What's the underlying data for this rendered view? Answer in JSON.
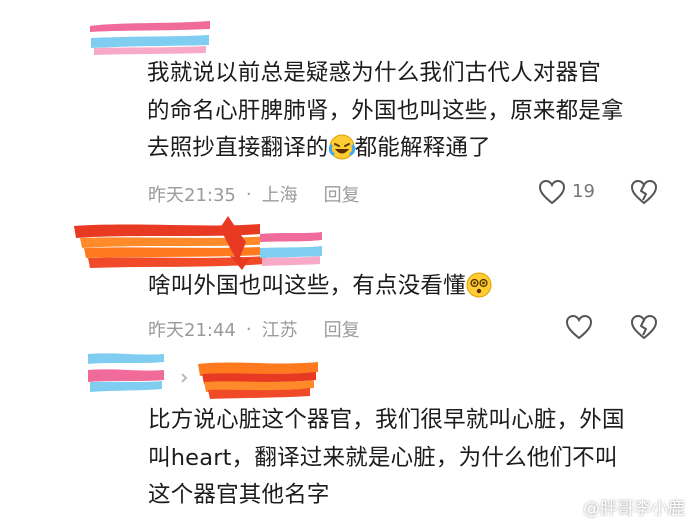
{
  "comments": [
    {
      "lines": [
        "我就说以前总是疑惑为什么我们古代人对器官",
        "的命名心肝脾肺肾，外国也叫这些，原来都是拿",
        "去照抄直接翻译的"
      ],
      "line3_after_emoji": "都能解释通了",
      "time": "昨天21:35",
      "location": "上海",
      "reply": "回复",
      "likes": "19"
    },
    {
      "text": "啥叫外国也叫这些，有点没看懂",
      "time": "昨天21:44",
      "location": "江苏",
      "reply": "回复"
    },
    {
      "lines": [
        "比方说心脏这个器官，我们很早就叫心脏，外国",
        "叫heart，翻译过来就是心脏，为什么他们不叫",
        "这个器官其他名字"
      ]
    }
  ],
  "meta_separator": "·",
  "watermark": "@胖哥李小鹿",
  "icons": {
    "like": "heart-outline-icon",
    "dislike": "broken-heart-icon",
    "laugh": "laughing-crying-emoji",
    "dizzy": "dizzy-face-emoji",
    "brand": "weibo-icon"
  },
  "colors": {
    "text": "#1c1c1c",
    "meta": "#9b9b9b",
    "redact_pink": "#f06a9a",
    "redact_blue": "#7fcdf0",
    "redact_orange": "#ff7a1f",
    "redact_red": "#e83a22"
  }
}
